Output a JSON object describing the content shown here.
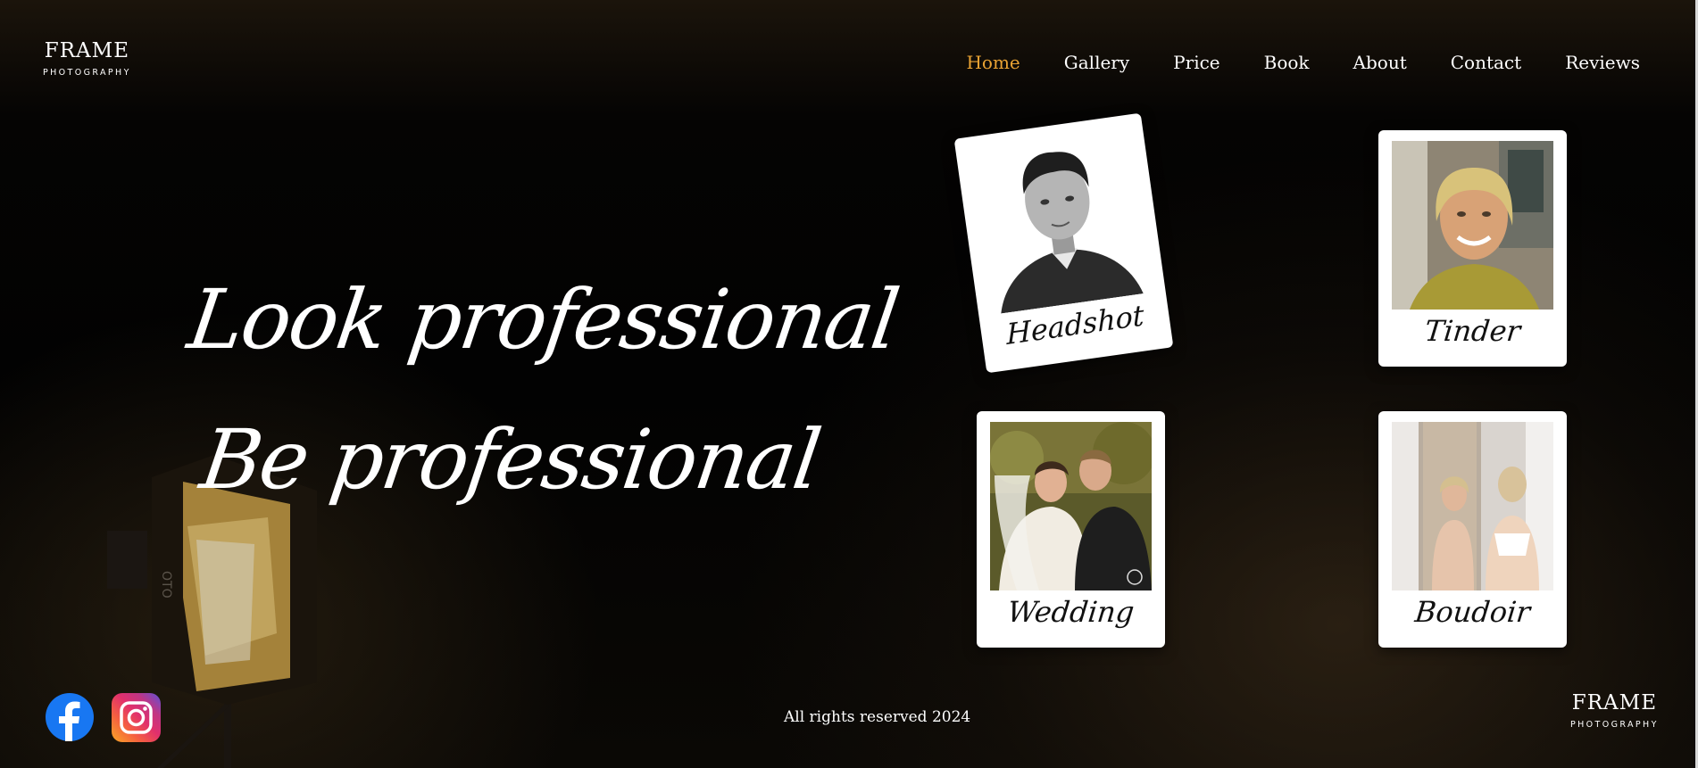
{
  "header": {
    "logo": {
      "word": "FRAME",
      "sub": "PHOTOGRAPHY"
    },
    "nav": [
      {
        "label": "Home",
        "active": true
      },
      {
        "label": "Gallery",
        "active": false
      },
      {
        "label": "Price",
        "active": false
      },
      {
        "label": "Book",
        "active": false
      },
      {
        "label": "About",
        "active": false
      },
      {
        "label": "Contact",
        "active": false
      },
      {
        "label": "Reviews",
        "active": false
      }
    ]
  },
  "hero": {
    "line1": "Look professional",
    "line2": "Be professional"
  },
  "cards": [
    {
      "caption": "Headshot"
    },
    {
      "caption": "Tinder"
    },
    {
      "caption": "Wedding"
    },
    {
      "caption": "Boudoir"
    }
  ],
  "social": [
    {
      "icon": "facebook-icon"
    },
    {
      "icon": "instagram-icon"
    }
  ],
  "footer": {
    "copyright": "All rights reserved 2024",
    "logo": {
      "word": "FRAME",
      "sub": "PHOTOGRAPHY"
    }
  },
  "colors": {
    "accent": "#e9a233",
    "background": "#020202",
    "facebook": "#1877f2"
  }
}
